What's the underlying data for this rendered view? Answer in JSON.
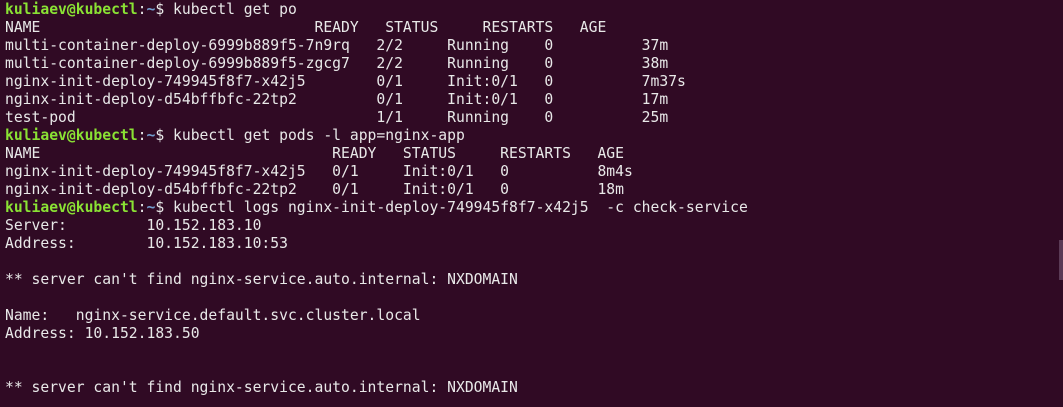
{
  "prompts": [
    {
      "user": "kuliaev@kubectl",
      "sep": ":",
      "path": "~",
      "symbol": "$ ",
      "command": "kubectl get po"
    },
    {
      "user": "kuliaev@kubectl",
      "sep": ":",
      "path": "~",
      "symbol": "$ ",
      "command": "kubectl get pods -l app=nginx-app"
    },
    {
      "user": "kuliaev@kubectl",
      "sep": ":",
      "path": "~",
      "symbol": "$ ",
      "command": "kubectl logs nginx-init-deploy-749945f8f7-x42j5  -c check-service"
    }
  ],
  "table1": {
    "header": "NAME                               READY   STATUS     RESTARTS   AGE",
    "rows": [
      "multi-container-deploy-6999b889f5-7n9rq   2/2     Running    0          37m",
      "multi-container-deploy-6999b889f5-zgcg7   2/2     Running    0          38m",
      "nginx-init-deploy-749945f8f7-x42j5        0/1     Init:0/1   0          7m37s",
      "nginx-init-deploy-d54bffbfc-22tp2         0/1     Init:0/1   0          17m",
      "test-pod                                  1/1     Running    0          25m"
    ]
  },
  "table2": {
    "header": "NAME                                 READY   STATUS     RESTARTS   AGE",
    "rows": [
      "nginx-init-deploy-749945f8f7-x42j5   0/1     Init:0/1   0          8m4s",
      "nginx-init-deploy-d54bffbfc-22tp2    0/1     Init:0/1   0          18m"
    ]
  },
  "logs": [
    "Server:         10.152.183.10",
    "Address:        10.152.183.10:53",
    "",
    "** server can't find nginx-service.auto.internal: NXDOMAIN",
    "",
    "Name:   nginx-service.default.svc.cluster.local",
    "Address: 10.152.183.50",
    "",
    "",
    "** server can't find nginx-service.auto.internal: NXDOMAIN"
  ],
  "colors": {
    "background": "#300a24",
    "text": "#e8e8e8",
    "user": "#8ae234",
    "path": "#729fcf"
  }
}
